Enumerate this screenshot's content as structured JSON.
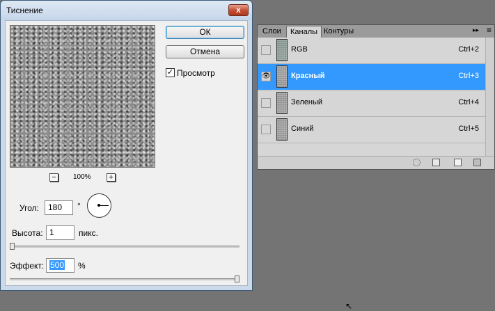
{
  "dialog": {
    "title": "Тиснение",
    "close_glyph": "x",
    "ok_label": "ОК",
    "cancel_label": "Отмена",
    "preview_label": "Просмотр",
    "preview_checked": true,
    "zoom_minus": "−",
    "zoom_plus": "+",
    "zoom_level": "100%",
    "angle_label": "Угол:",
    "angle_value": "180",
    "angle_unit": "°",
    "height_label": "Высота:",
    "height_value": "1",
    "height_unit": "пикс.",
    "height_slider_fraction": 0.0,
    "effect_label": "Эффект:",
    "effect_value": "500",
    "effect_unit": "%",
    "effect_slider_fraction": 1.0
  },
  "panel": {
    "tabs": [
      {
        "label": "Слои"
      },
      {
        "label": "Каналы"
      },
      {
        "label": "Контуры"
      }
    ],
    "active_tab": "Каналы",
    "menu_glyph": "▸▸",
    "options_glyph": "≡",
    "channels": [
      {
        "name": "RGB",
        "shortcut": "Ctrl+2",
        "visible": false,
        "selected": false
      },
      {
        "name": "Красный",
        "shortcut": "Ctrl+3",
        "visible": true,
        "selected": true
      },
      {
        "name": "Зеленый",
        "shortcut": "Ctrl+4",
        "visible": false,
        "selected": false
      },
      {
        "name": "Синий",
        "shortcut": "Ctrl+5",
        "visible": false,
        "selected": false
      }
    ],
    "eye_glyph": "👁",
    "selection_color": "#3399ff"
  }
}
